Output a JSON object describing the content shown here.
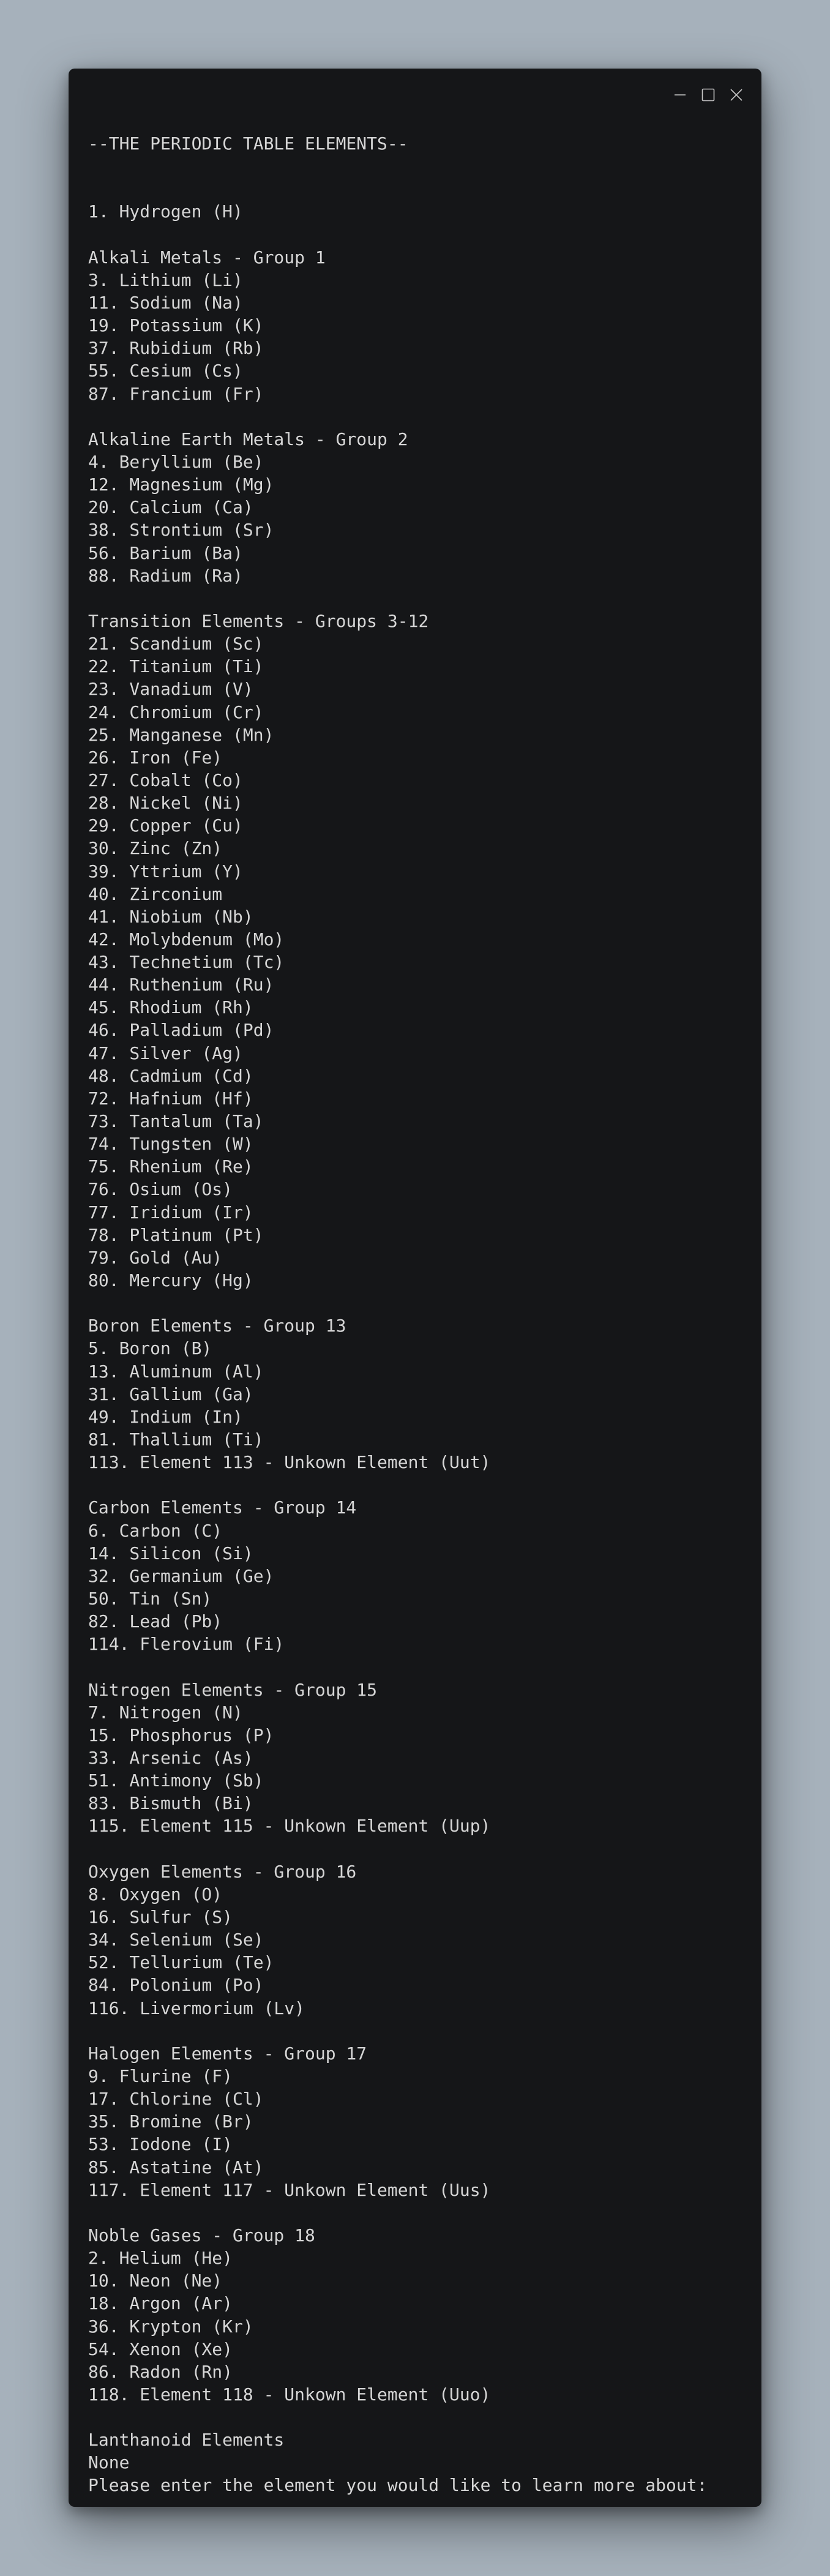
{
  "window": {
    "controls": [
      "minimize-icon",
      "maximize-icon",
      "close-icon"
    ]
  },
  "terminal": {
    "lines": [
      "--THE PERIODIC TABLE ELEMENTS--",
      "",
      "",
      "1. Hydrogen (H)",
      "",
      "Alkali Metals - Group 1",
      "3. Lithium (Li)",
      "11. Sodium (Na)",
      "19. Potassium (K)",
      "37. Rubidium (Rb)",
      "55. Cesium (Cs)",
      "87. Francium (Fr)",
      "",
      "Alkaline Earth Metals - Group 2",
      "4. Beryllium (Be)",
      "12. Magnesium (Mg)",
      "20. Calcium (Ca)",
      "38. Strontium (Sr)",
      "56. Barium (Ba)",
      "88. Radium (Ra)",
      "",
      "Transition Elements - Groups 3-12",
      "21. Scandium (Sc)",
      "22. Titanium (Ti)",
      "23. Vanadium (V)",
      "24. Chromium (Cr)",
      "25. Manganese (Mn)",
      "26. Iron (Fe)",
      "27. Cobalt (Co)",
      "28. Nickel (Ni)",
      "29. Copper (Cu)",
      "30. Zinc (Zn)",
      "39. Yttrium (Y)",
      "40. Zirconium",
      "41. Niobium (Nb)",
      "42. Molybdenum (Mo)",
      "43. Technetium (Tc)",
      "44. Ruthenium (Ru)",
      "45. Rhodium (Rh)",
      "46. Palladium (Pd)",
      "47. Silver (Ag)",
      "48. Cadmium (Cd)",
      "72. Hafnium (Hf)",
      "73. Tantalum (Ta)",
      "74. Tungsten (W)",
      "75. Rhenium (Re)",
      "76. Osium (Os)",
      "77. Iridium (Ir)",
      "78. Platinum (Pt)",
      "79. Gold (Au)",
      "80. Mercury (Hg)",
      "",
      "Boron Elements - Group 13",
      "5. Boron (B)",
      "13. Aluminum (Al)",
      "31. Gallium (Ga)",
      "49. Indium (In)",
      "81. Thallium (Ti)",
      "113. Element 113 - Unkown Element (Uut)",
      "",
      "Carbon Elements - Group 14",
      "6. Carbon (C)",
      "14. Silicon (Si)",
      "32. Germanium (Ge)",
      "50. Tin (Sn)",
      "82. Lead (Pb)",
      "114. Flerovium (Fi)",
      "",
      "Nitrogen Elements - Group 15",
      "7. Nitrogen (N)",
      "15. Phosphorus (P)",
      "33. Arsenic (As)",
      "51. Antimony (Sb)",
      "83. Bismuth (Bi)",
      "115. Element 115 - Unkown Element (Uup)",
      "",
      "Oxygen Elements - Group 16",
      "8. Oxygen (O)",
      "16. Sulfur (S)",
      "34. Selenium (Se)",
      "52. Tellurium (Te)",
      "84. Polonium (Po)",
      "116. Livermorium (Lv)",
      "",
      "Halogen Elements - Group 17",
      "9. Flurine (F)",
      "17. Chlorine (Cl)",
      "35. Bromine (Br)",
      "53. Iodone (I)",
      "85. Astatine (At)",
      "117. Element 117 - Unkown Element (Uus)",
      "",
      "Noble Gases - Group 18",
      "2. Helium (He)",
      "10. Neon (Ne)",
      "18. Argon (Ar)",
      "36. Krypton (Kr)",
      "54. Xenon (Xe)",
      "86. Radon (Rn)",
      "118. Element 118 - Unkown Element (Uuo)",
      "",
      "Lanthanoid Elements",
      "None",
      "Please enter the element you would like to learn more about: "
    ]
  },
  "colors": {
    "page_background": "#a6b1bb",
    "window_background": "#151618",
    "text": "#d6d6d6",
    "controls": "#c8c8c8"
  }
}
